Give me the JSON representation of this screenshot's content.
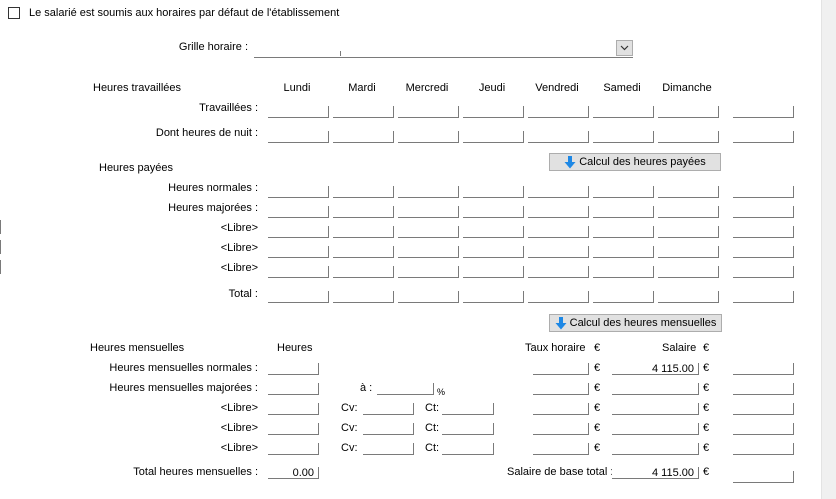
{
  "top": {
    "checkbox_label": "Le salarié est soumis aux horaires par défaut de l'établissement",
    "checked": false
  },
  "grille": {
    "label": "Grille horaire :",
    "value": ""
  },
  "days": [
    "Lundi",
    "Mardi",
    "Mercredi",
    "Jeudi",
    "Vendredi",
    "Samedi",
    "Dimanche"
  ],
  "worked": {
    "title": "Heures travaillées",
    "rows": [
      "Travaillées :",
      "Dont heures de nuit :"
    ]
  },
  "paid": {
    "title": "Heures payées",
    "button": "Calcul des heures payées",
    "rows": [
      "Heures normales :",
      "Heures majorées :",
      "<Libre>",
      "<Libre>",
      "<Libre>"
    ],
    "total": "Total :"
  },
  "monthly": {
    "button": "Calcul des heures mensuelles",
    "title": "Heures mensuelles",
    "col_hours": "Heures",
    "col_rate": "Taux horaire",
    "col_salary": "Salaire",
    "currency": "€",
    "rows": [
      "Heures mensuelles normales :",
      "Heures mensuelles majorées :",
      "<Libre>",
      "<Libre>",
      "<Libre>"
    ],
    "a_label": "à :",
    "percent": "%",
    "cv_label": "Cv:",
    "ct_label": "Ct:",
    "salary_normal": "4 115.00",
    "total_label": "Total heures mensuelles :",
    "total_hours": "0.00",
    "salary_total_label": "Salaire de base total :",
    "salary_total": "4 115.00"
  }
}
